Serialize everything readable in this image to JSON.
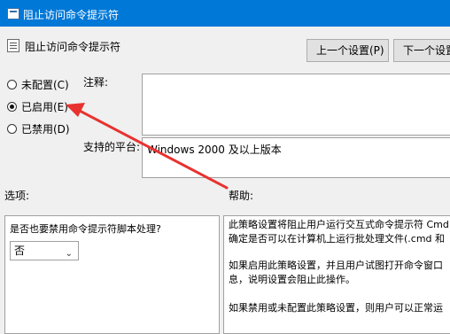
{
  "window": {
    "title": "阻止访问命令提示符"
  },
  "header": {
    "title": "阻止访问命令提示符",
    "prev_button": "上一个设置(P)",
    "next_button": "下一个设置"
  },
  "radios": [
    {
      "label": "未配置(C)",
      "selected": false
    },
    {
      "label": "已启用(E)",
      "selected": true
    },
    {
      "label": "已禁用(D)",
      "selected": false
    }
  ],
  "comment": {
    "label": "注释:",
    "value": ""
  },
  "supported": {
    "label": "支持的平台:",
    "value": "Windows 2000 及以上版本"
  },
  "options": {
    "label": "选项:",
    "question": "是否也要禁用命令提示符脚本处理?",
    "select_value": "否"
  },
  "help": {
    "label": "帮助:",
    "lines": [
      "此策略设置将阻止用户运行交互式命令提示符 Cmd",
      "确定是否可以在计算机上运行批处理文件(.cmd 和",
      "如果启用此策略设置，并且用户试图打开命令窗口",
      "息，说明设置会阻止此操作。",
      "如果禁用或未配置此策略设置，则用户可以正常运"
    ]
  },
  "annotation": {
    "arrow_color": "#e8322f"
  }
}
